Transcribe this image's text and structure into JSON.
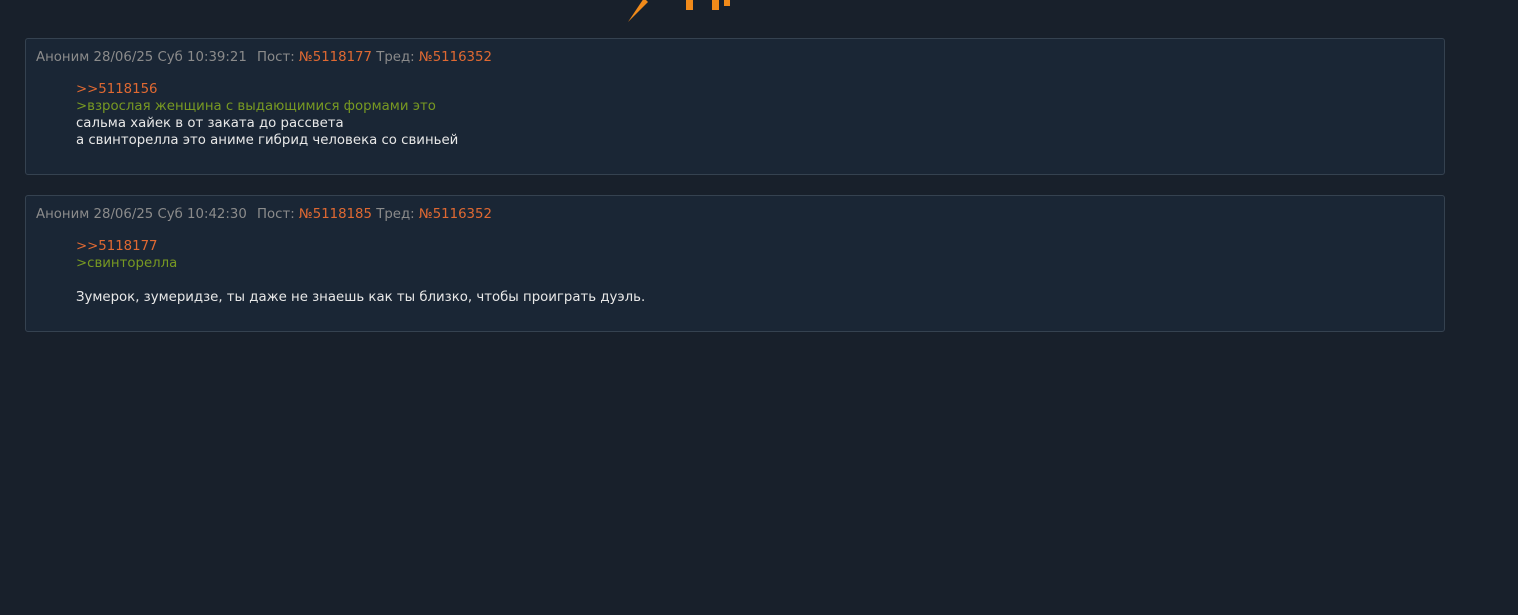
{
  "colors": {
    "background": "#18202b",
    "post_background": "#1a2635",
    "post_border": "#354250",
    "reply_link": "#e06932",
    "greentext": "#789922",
    "logo_orange": "#f08a1a"
  },
  "header_logo": {
    "icon": "site-logo-icon"
  },
  "posts": [
    {
      "author": "Аноним",
      "date": "28/06/25 Суб 10:39:21",
      "post_label": "Пост:",
      "post_number": "№5118177",
      "thread_label": "Тред:",
      "thread_number": "№5116352",
      "reply_to": ">>5118156",
      "quote": ">взрослая женщина с выдающимися формами это",
      "lines": [
        "сальма хайек в от заката до рассвета",
        "а свинторелла это аниме гибрид человека со свиньей"
      ]
    },
    {
      "author": "Аноним",
      "date": "28/06/25 Суб 10:42:30",
      "post_label": "Пост:",
      "post_number": "№5118185",
      "thread_label": "Тред:",
      "thread_number": "№5116352",
      "reply_to": ">>5118177",
      "quote": ">свинторелла",
      "lines": [
        "Зумерок, зумеридзе, ты даже не знаешь как ты близко, чтобы проиграть дуэль."
      ]
    }
  ]
}
